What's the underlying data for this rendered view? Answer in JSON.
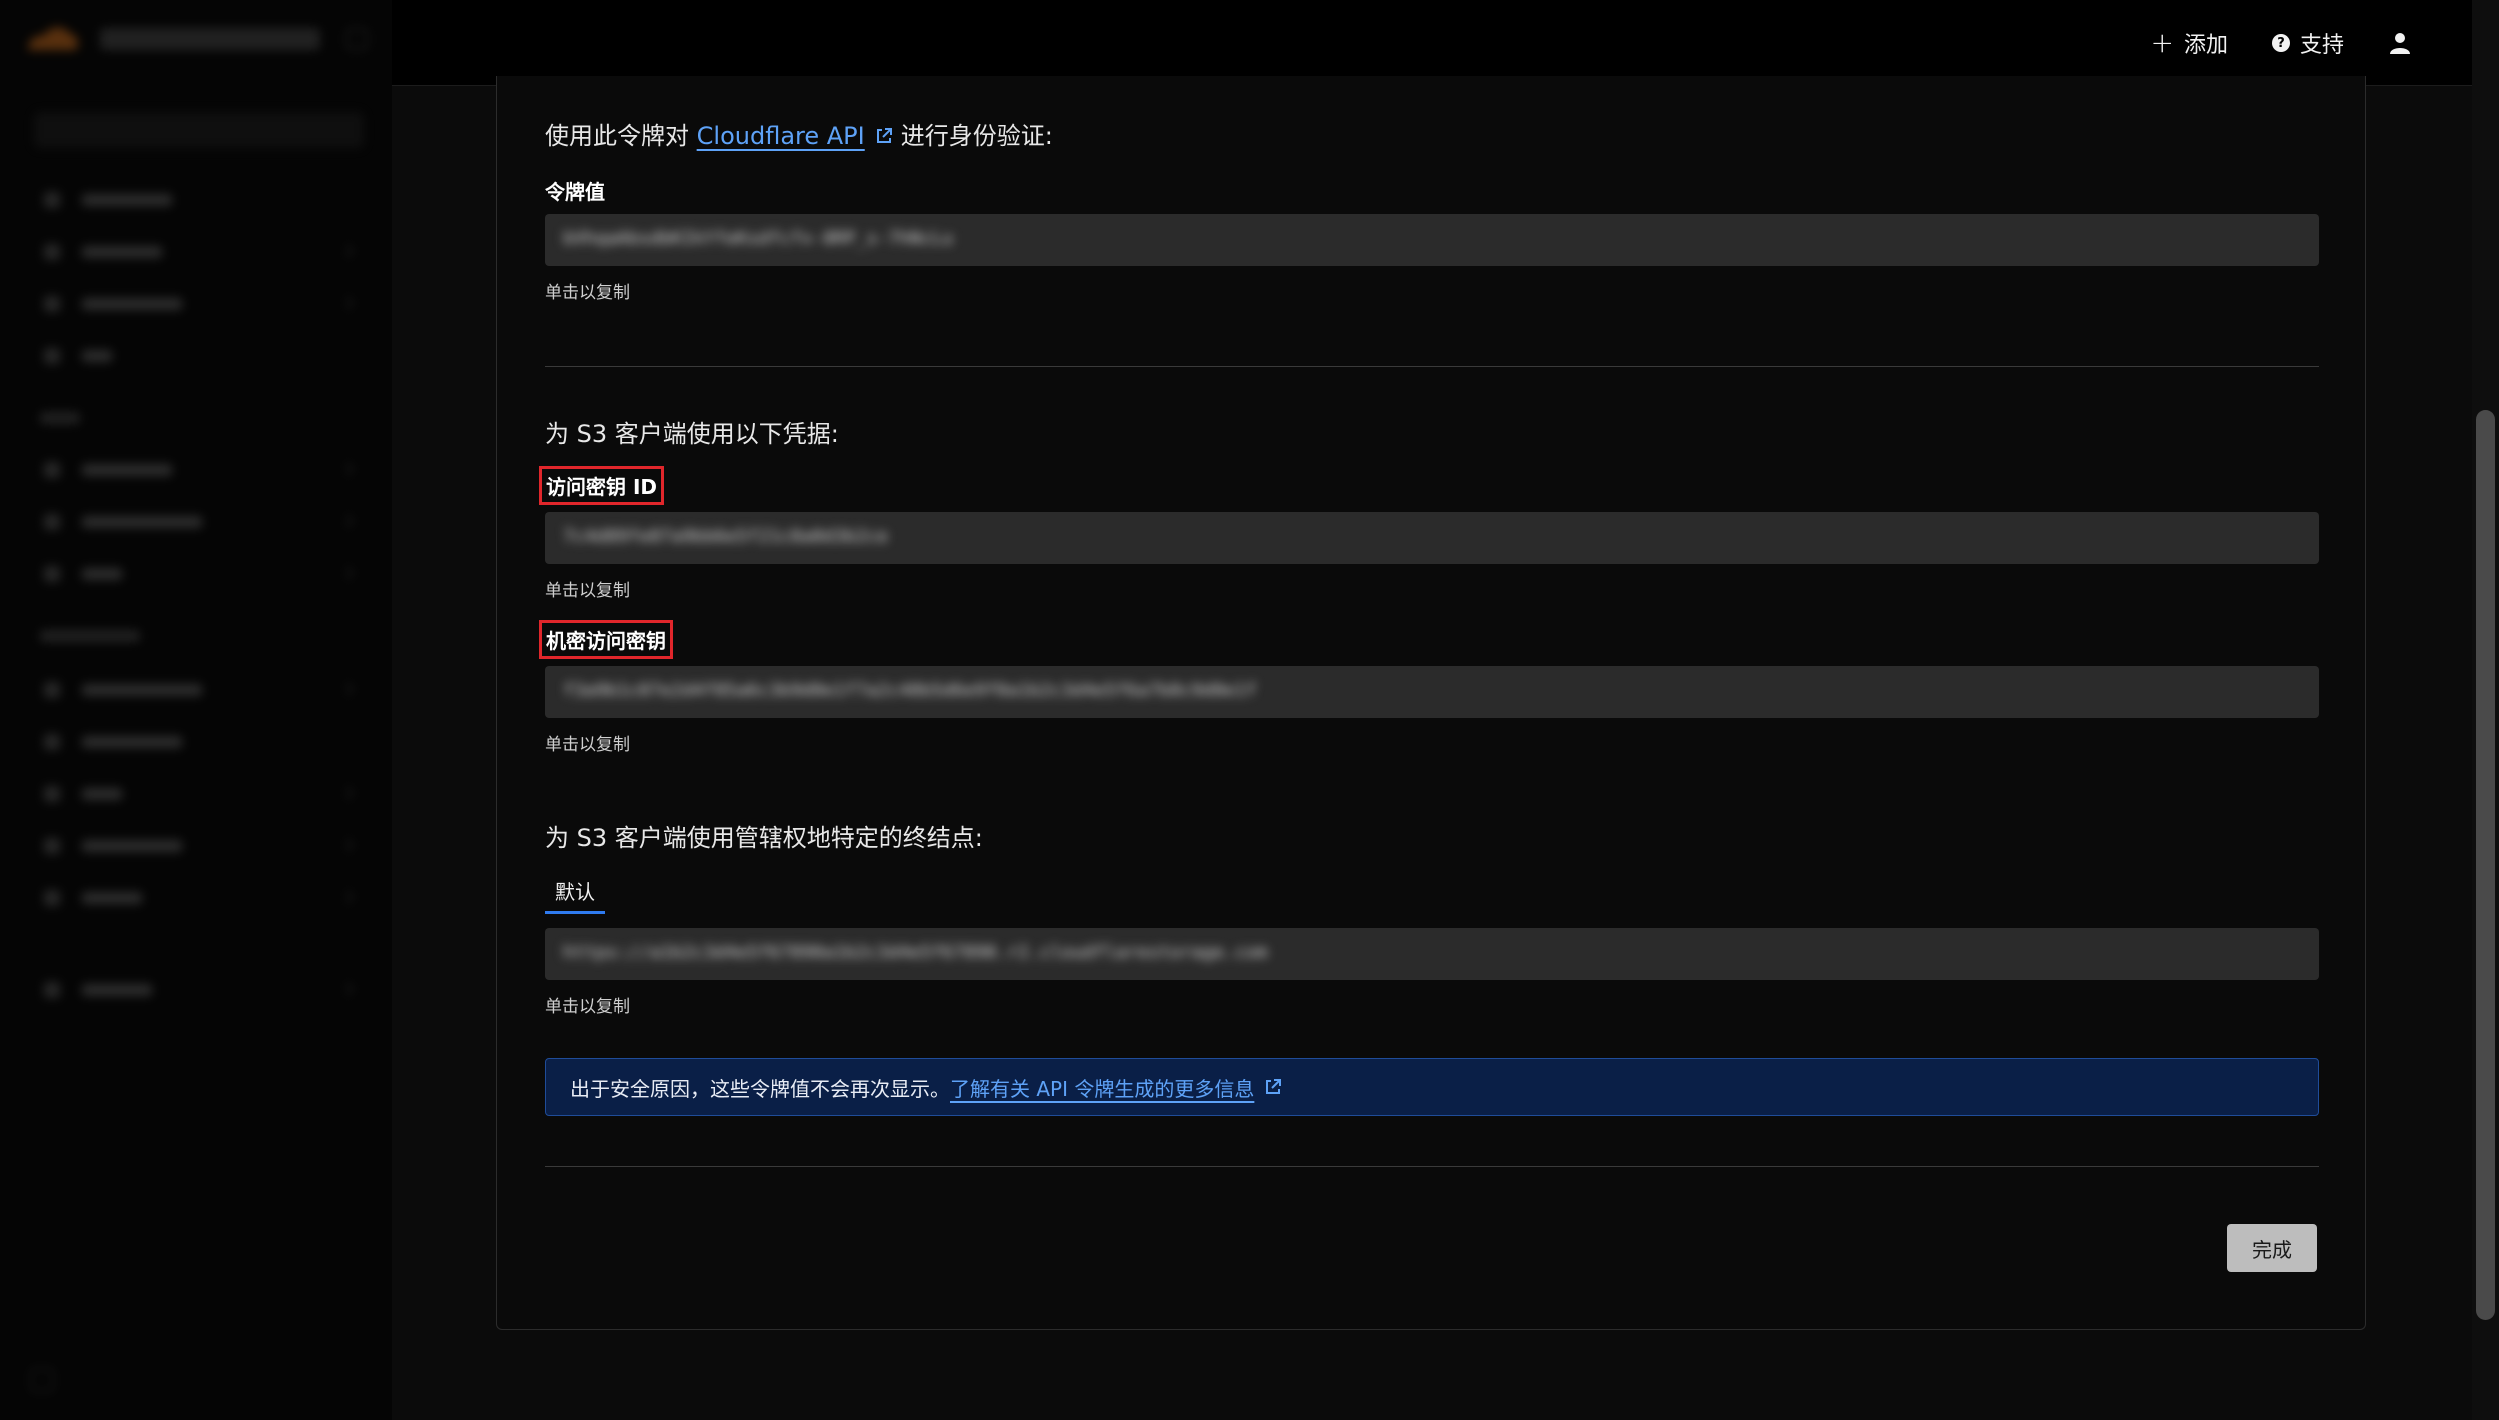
{
  "topbar": {
    "add_label": "添加",
    "support_label": "支持"
  },
  "api_section": {
    "prefix": "使用此令牌对",
    "link_text": "Cloudflare API",
    "suffix": "进行身份验证:",
    "token_label": "令牌值",
    "token_value": "bVhqaAbsdbKIkYfeKsdfcfx-8RP_s-7hNcLu",
    "copy_hint": "单击以复制"
  },
  "s3_section": {
    "heading": "为 S3 客户端使用以下凭据:",
    "access_key_label": "访问密钥 ID",
    "access_key_value": "7c4d89fe07a9bb6e5f21c8a0d3b2ce",
    "access_copy_hint": "单击以复制",
    "secret_key_label": "机密访问密钥",
    "secret_key_value": "f3a9b1c07e2d4f85a6c3b9d0e1f7a2c48b5d6e9f0a1b2c3d4e5f6a7b8c9d0e1f",
    "secret_copy_hint": "单击以复制"
  },
  "endpoint_section": {
    "heading": "为 S3 客户端使用管辖权地特定的终结点:",
    "tab_default": "默认",
    "endpoint_value": "https://a1b2c3d4e5f67890a1b2c3d4e5f67890.r2.cloudflarestorage.com",
    "copy_hint": "单击以复制"
  },
  "notice": {
    "text": "出于安全原因，这些令牌值不会再次显示。",
    "link_text": "了解有关 API 令牌生成的更多信息"
  },
  "footer": {
    "done_label": "完成"
  },
  "colors": {
    "accent": "#2f7bf0",
    "link": "#5ea2f7",
    "highlight_box": "#e0262b",
    "notice_bg": "#0a1f47"
  }
}
